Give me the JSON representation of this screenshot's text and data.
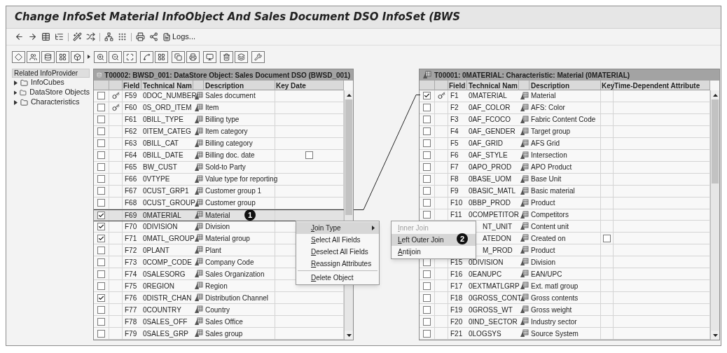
{
  "window": {
    "title": "Change InfoSet Material InfoObject And Sales Document DSO InfoSet (BWS"
  },
  "toolbar": {
    "logs_button": "Logs..."
  },
  "related_infoprovider": {
    "title": "Related InfoProvider",
    "items": [
      {
        "label": "InfoCubes",
        "expanded": false
      },
      {
        "label": "DataStore Objects",
        "expanded": false
      },
      {
        "label": "Characteristics",
        "expanded": false
      }
    ]
  },
  "tables": [
    {
      "kind": "datastore",
      "title": "T00002: BWSD_001: DataStore Object: Sales Document DSO (BWSD_001)",
      "columns": [
        "Field",
        "Technical Nam",
        "Description",
        "Key Date"
      ],
      "rows": [
        {
          "checked": false,
          "key": true,
          "field": "F59",
          "technical_name": "0DOC_NUMBER",
          "description": "Sales document",
          "selected": false,
          "key_date_checkbox": false
        },
        {
          "checked": false,
          "key": true,
          "field": "F60",
          "technical_name": "0S_ORD_ITEM",
          "description": "Item",
          "selected": false,
          "key_date_checkbox": false
        },
        {
          "checked": false,
          "key": false,
          "field": "F61",
          "technical_name": "0BILL_TYPE",
          "description": "Billing type",
          "selected": false,
          "key_date_checkbox": false
        },
        {
          "checked": false,
          "key": false,
          "field": "F62",
          "technical_name": "0ITEM_CATEG",
          "description": "Item category",
          "selected": false,
          "key_date_checkbox": false
        },
        {
          "checked": false,
          "key": false,
          "field": "F63",
          "technical_name": "0BILL_CAT",
          "description": "Billing category",
          "selected": false,
          "key_date_checkbox": false
        },
        {
          "checked": false,
          "key": false,
          "field": "F64",
          "technical_name": "0BILL_DATE",
          "description": "Billing doc. date",
          "selected": false,
          "key_date": {
            "checked": false
          }
        },
        {
          "checked": false,
          "key": false,
          "field": "F65",
          "technical_name": "BW_CUST",
          "description": "Sold-to Party",
          "selected": false,
          "key_date_checkbox": false
        },
        {
          "checked": false,
          "key": false,
          "field": "F66",
          "technical_name": "0VTYPE",
          "description": "Value type for reporting",
          "selected": false,
          "key_date_checkbox": false
        },
        {
          "checked": false,
          "key": false,
          "field": "F67",
          "technical_name": "0CUST_GRP1",
          "description": "Customer group 1",
          "selected": false,
          "key_date_checkbox": false
        },
        {
          "checked": false,
          "key": false,
          "field": "F68",
          "technical_name": "0CUST_GROUP",
          "description": "Customer group",
          "selected": false,
          "key_date_checkbox": false
        },
        {
          "checked": true,
          "key": false,
          "field": "F69",
          "technical_name": "0MATERIAL",
          "description": "Material",
          "selected": true,
          "key_date_checkbox": false
        },
        {
          "checked": true,
          "key": false,
          "field": "F70",
          "technical_name": "0DIVISION",
          "description": "Division",
          "selected": false,
          "key_date_checkbox": false
        },
        {
          "checked": true,
          "key": false,
          "field": "F71",
          "technical_name": "0MATL_GROUP",
          "description": "Material group",
          "selected": false,
          "key_date_checkbox": false
        },
        {
          "checked": false,
          "key": false,
          "field": "F72",
          "technical_name": "0PLANT",
          "description": "Plant",
          "selected": false,
          "key_date_checkbox": false
        },
        {
          "checked": false,
          "key": false,
          "field": "F73",
          "technical_name": "0COMP_CODE",
          "description": "Company Code",
          "selected": false,
          "key_date_checkbox": false
        },
        {
          "checked": false,
          "key": false,
          "field": "F74",
          "technical_name": "0SALESORG",
          "description": "Sales Organization",
          "selected": false,
          "key_date_checkbox": false
        },
        {
          "checked": false,
          "key": false,
          "field": "F75",
          "technical_name": "0REGION",
          "description": "Region",
          "selected": false,
          "key_date_checkbox": false
        },
        {
          "checked": true,
          "key": false,
          "field": "F76",
          "technical_name": "0DISTR_CHAN",
          "description": "Distribution Channel",
          "selected": false,
          "key_date_checkbox": false
        },
        {
          "checked": false,
          "key": false,
          "field": "F77",
          "technical_name": "0COUNTRY",
          "description": "Country",
          "selected": false,
          "key_date_checkbox": false
        },
        {
          "checked": false,
          "key": false,
          "field": "F78",
          "technical_name": "0SALES_OFF",
          "description": "Sales Office",
          "selected": false,
          "key_date_checkbox": false
        },
        {
          "checked": false,
          "key": false,
          "field": "F79",
          "technical_name": "0SALES_GRP",
          "description": "Sales group",
          "selected": false,
          "key_date_checkbox": false
        }
      ]
    },
    {
      "kind": "characteristic",
      "title": "T00001: 0MATERIAL: Characteristic: Material (0MATERIAL)",
      "columns": [
        "Field",
        "Technical Nam",
        "Description",
        "Key",
        "Time-Dependent Attribute"
      ],
      "rows": [
        {
          "checked": true,
          "key": true,
          "field": "F1",
          "technical_name": "0MATERIAL",
          "description": "Material",
          "selected": false,
          "key_date_checkbox": false
        },
        {
          "checked": false,
          "key": false,
          "field": "F2",
          "technical_name": "0AF_COLOR",
          "description": "AFS: Color",
          "selected": false,
          "key_date_checkbox": false
        },
        {
          "checked": false,
          "key": false,
          "field": "F3",
          "technical_name": "0AF_FCOCO",
          "description": "Fabric Content Code",
          "selected": false,
          "key_date_checkbox": false
        },
        {
          "checked": false,
          "key": false,
          "field": "F4",
          "technical_name": "0AF_GENDER",
          "description": "Target group",
          "selected": false,
          "key_date_checkbox": false
        },
        {
          "checked": false,
          "key": false,
          "field": "F5",
          "technical_name": "0AF_GRID",
          "description": "AFS Grid",
          "selected": false,
          "key_date_checkbox": false
        },
        {
          "checked": false,
          "key": false,
          "field": "F6",
          "technical_name": "0AF_STYLE",
          "description": "Intersection",
          "selected": false,
          "key_date_checkbox": false
        },
        {
          "checked": false,
          "key": false,
          "field": "F7",
          "technical_name": "0APO_PROD",
          "description": "APO Product",
          "selected": false,
          "key_date_checkbox": false
        },
        {
          "checked": false,
          "key": false,
          "field": "F8",
          "technical_name": "0BASE_UOM",
          "description": "Base Unit",
          "selected": false,
          "key_date_checkbox": false
        },
        {
          "checked": false,
          "key": false,
          "field": "F9",
          "technical_name": "0BASIC_MATL",
          "description": "Basic material",
          "selected": false,
          "key_date_checkbox": false
        },
        {
          "checked": false,
          "key": false,
          "field": "F10",
          "technical_name": "0BBP_PROD",
          "description": "Product",
          "selected": false,
          "key_date_checkbox": false
        },
        {
          "checked": false,
          "key": false,
          "field": "F11",
          "technical_name": "0COMPETITOR",
          "description": "Competitors",
          "selected": false,
          "key_date_checkbox": false
        },
        {
          "key": false,
          "technical_name": "NT_UNIT",
          "description": "Content unit",
          "selected": false,
          "key_date_checkbox": false
        },
        {
          "key": false,
          "technical_name": "ATEDON",
          "description": "Created on",
          "selected": false,
          "key_date": {
            "checked": false
          }
        },
        {
          "key": false,
          "technical_name": "M_PROD",
          "description": "Product",
          "selected": false,
          "key_date_checkbox": false
        },
        {
          "checked": false,
          "key": false,
          "field": "F15",
          "technical_name": "0DIVISION",
          "description": "Division",
          "selected": false,
          "key_date_checkbox": false
        },
        {
          "checked": false,
          "key": false,
          "field": "F16",
          "technical_name": "0EANUPC",
          "description": "EAN/UPC",
          "selected": false,
          "key_date_checkbox": false
        },
        {
          "checked": false,
          "key": false,
          "field": "F17",
          "technical_name": "0EXTMATLGRP",
          "description": "Ext. matl group",
          "selected": false,
          "key_date_checkbox": false
        },
        {
          "checked": false,
          "key": false,
          "field": "F18",
          "technical_name": "0GROSS_CONT",
          "description": "Gross contents",
          "selected": false,
          "key_date_checkbox": false
        },
        {
          "checked": false,
          "key": false,
          "field": "F19",
          "technical_name": "0GROSS_WT",
          "description": "Gross weight",
          "selected": false,
          "key_date_checkbox": false
        },
        {
          "checked": false,
          "key": false,
          "field": "F20",
          "technical_name": "0IND_SECTOR",
          "description": "Industry sector",
          "selected": false,
          "key_date_checkbox": false
        },
        {
          "checked": false,
          "key": false,
          "field": "F21",
          "technical_name": "0LOGSYS",
          "description": "Source System",
          "selected": false,
          "key_date_checkbox": false
        }
      ]
    }
  ],
  "context_menu": {
    "items": [
      {
        "label": "Join Type",
        "submenu": true,
        "selected": true
      },
      {
        "label": "Select All Fields",
        "submenu": false,
        "selected": false
      },
      {
        "label": "Deselect All Fields",
        "submenu": false,
        "selected": false
      },
      {
        "label": "Reassign Attributes",
        "submenu": false,
        "selected": false
      },
      {
        "label": "Delete Object",
        "submenu": false,
        "selected": false
      }
    ]
  },
  "join_type_submenu": {
    "items": [
      {
        "label": "Inner Join",
        "disabled": true,
        "selected": false
      },
      {
        "label": "Left Outer Join",
        "disabled": false,
        "selected": true
      },
      {
        "label": "Antijoin",
        "disabled": false,
        "selected": false
      }
    ]
  },
  "callouts": [
    {
      "number": "1"
    },
    {
      "number": "2"
    }
  ]
}
